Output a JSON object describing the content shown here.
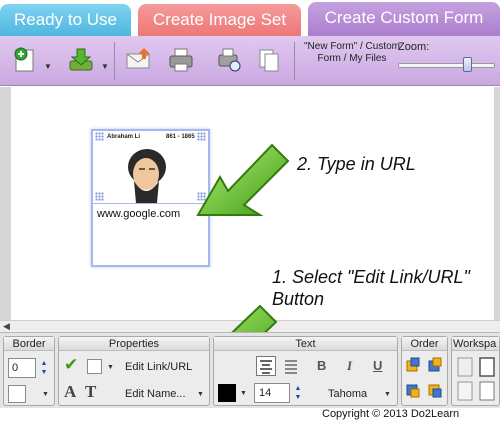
{
  "tabs": [
    {
      "label": "Ready to Use"
    },
    {
      "label": "Create Image Set"
    },
    {
      "label": "Create Custom Form"
    }
  ],
  "toolbar": {
    "form_label": "\"New Form\" / Custom Form / My Files",
    "zoom_label": "Zoom:",
    "zoom_level": 0.66
  },
  "card": {
    "caption": "Abraham Li",
    "years": "861 - 1865",
    "url": "www.google.com"
  },
  "instructions": {
    "step2": "2. Type in URL",
    "step1": "1. Select \"Edit Link/URL\" Button"
  },
  "panel": {
    "border": {
      "title": "Border",
      "width_value": "0"
    },
    "properties": {
      "title": "Properties",
      "edit_link_label": "Edit Link/URL",
      "edit_name_label": "Edit Name..."
    },
    "text": {
      "title": "Text",
      "font_size": "14",
      "font_name": "Tahoma",
      "bold": "B",
      "italic": "I",
      "underline": "U"
    },
    "order": {
      "title": "Order"
    },
    "workspace": {
      "title": "Workspa"
    }
  },
  "copyright": "Copyright © 2013 Do2Learn",
  "colors": {
    "tab_ready": "#5fc2e8",
    "tab_set": "#f08484",
    "tab_custom": "#b48ad6",
    "toolbar": "#d6b9ea",
    "arrow_green": "#5ec21a"
  }
}
